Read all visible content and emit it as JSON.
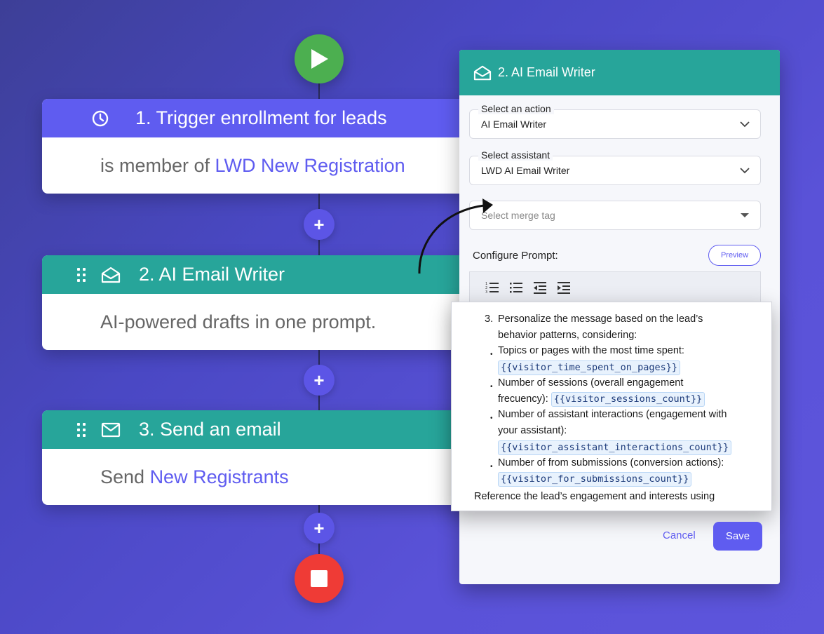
{
  "flow": {
    "steps": [
      {
        "title": "1. Trigger enrollment for leads",
        "body_prefix": "is member of ",
        "body_link": "LWD New Registration"
      },
      {
        "title": "2. AI Email Writer",
        "body_prefix": "AI-powered drafts in one prompt.",
        "body_link": ""
      },
      {
        "title": "3. Send an email",
        "body_prefix": "Send ",
        "body_link": "New Registrants"
      }
    ],
    "add_label": "+"
  },
  "panel": {
    "title": "2. AI Email Writer",
    "action_label": "Select an action",
    "action_value": "AI Email Writer",
    "assistant_label": "Select assistant",
    "assistant_value": "LWD AI Email Writer",
    "merge_placeholder": "Select merge tag",
    "configure_label": "Configure Prompt:",
    "preview_label": "Preview",
    "cancel_label": "Cancel",
    "save_label": "Save"
  },
  "editor": {
    "num": "3.",
    "line1": "Personalize the message based on the lead’s",
    "line2": "behavior patterns, considering:",
    "b1": "Topics or pages with the most time spent:",
    "tag1": "{{visitor_time_spent_on_pages}}",
    "b2a": "Number of sessions (overall engagement",
    "b2b": "frecuency):",
    "tag2": "{{visitor_sessions_count}}",
    "b3a": "Number of assistant interactions (engagement with",
    "b3b": "your assistant):",
    "tag3": "{{visitor_assistant_interactions_count}}",
    "b4": "Number of from submissions (conversion actions):",
    "tag4": "{{visitor_for_submissions_count}}",
    "last": "Reference the lead’s engagement and interests using"
  },
  "colors": {
    "accent": "#5f5cf0",
    "teal": "#27a59a",
    "start": "#4caf50",
    "stop": "#ef3b36"
  }
}
